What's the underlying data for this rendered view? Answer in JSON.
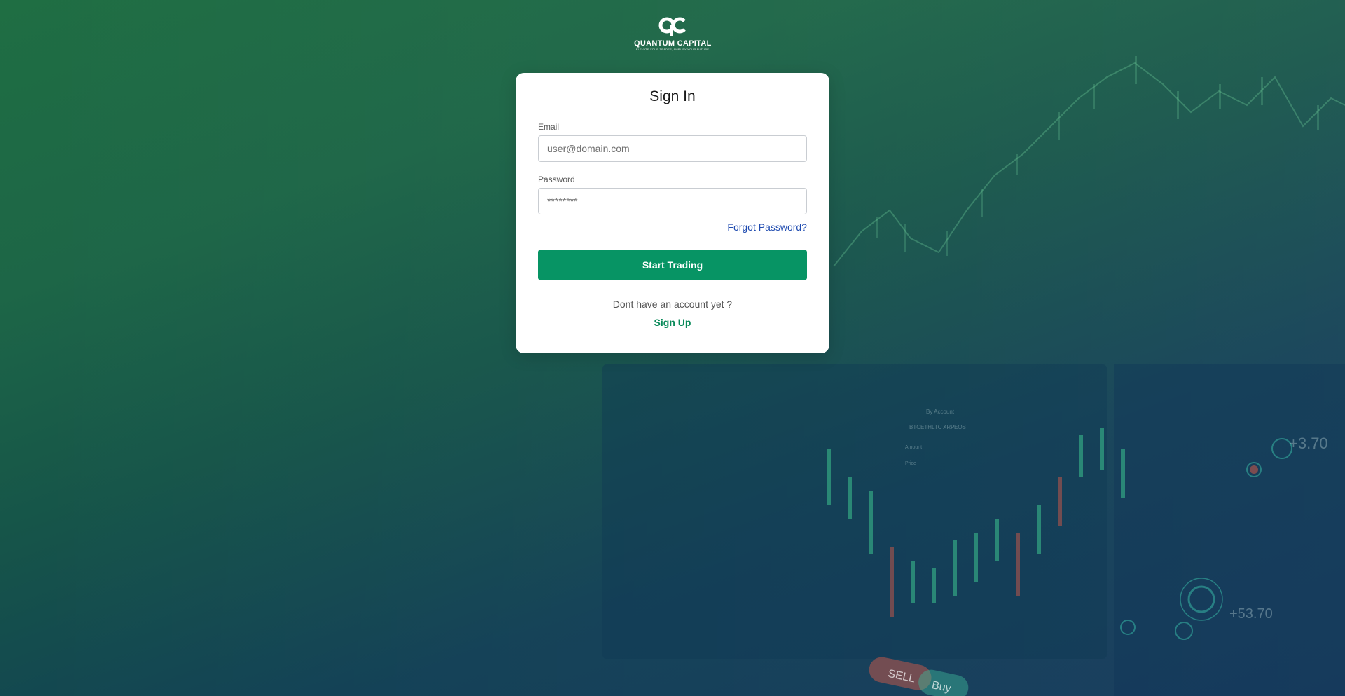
{
  "brand": {
    "logo_icon": "qc-monogram-icon",
    "name": "QUANTUM CAPITAL",
    "tagline": "ELEVATE YOUR TRADES, AMPLIFY YOUR FUTURE"
  },
  "form": {
    "title": "Sign In",
    "email_label": "Email",
    "email_placeholder": "user@domain.com",
    "password_label": "Password",
    "password_placeholder": "********",
    "forgot_label": "Forgot Password?",
    "submit_label": "Start Trading",
    "no_account_text": "Dont have an account yet ?",
    "signup_label": "Sign Up"
  },
  "background": {
    "trade_buttons": [
      "SELL",
      "Buy"
    ],
    "tickers": [
      "BTC",
      "ETH",
      "LTC",
      "XRP",
      "EOS"
    ],
    "panel_title": "By Account",
    "amount_label": "Amount",
    "price_label": "Price",
    "map_values": [
      "+3.70",
      "+53.70"
    ]
  },
  "colors": {
    "accent": "#079464",
    "link": "#1f4bb0",
    "signup": "#0a8a5a"
  }
}
